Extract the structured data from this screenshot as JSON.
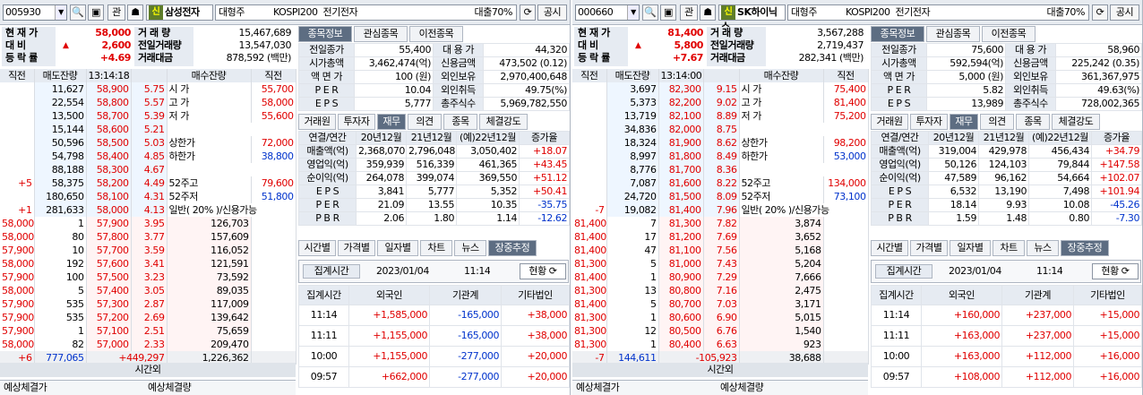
{
  "panels": [
    {
      "code": "005930",
      "btn_kwan": "관",
      "btn_sin": "신",
      "name": "삼성전자",
      "info": "대형주",
      "market": "KOSPI200",
      "sector": "전기전자",
      "loan": "대출70%",
      "gongsi": "공시",
      "cur_label": "현 재 가",
      "cur_price": "58,000",
      "diff_label": "대 비",
      "diff": "2,600",
      "rate_label": "등 락 률",
      "rate": "+4.69",
      "vol_label": "거 래 량",
      "vol": "15,467,689",
      "pvol_label": "전일거래량",
      "pvol": "13,547,030",
      "amt_label": "거래대금",
      "amt": "878,592",
      "amt_unit": "(백만)",
      "ob_head": [
        "직전",
        "매도잔량",
        "13:14:18",
        "",
        "매수잔량",
        "직전"
      ],
      "asks": [
        [
          "",
          "11,627",
          "58,900",
          "5.75",
          "시  가",
          "55,700"
        ],
        [
          "",
          "22,554",
          "58,800",
          "5.57",
          "고  가",
          "58,000"
        ],
        [
          "",
          "13,500",
          "58,700",
          "5.39",
          "저  가",
          "55,600"
        ],
        [
          "",
          "15,144",
          "58,600",
          "5.21",
          "",
          ""
        ],
        [
          "",
          "50,596",
          "58,500",
          "5.03",
          "상한가",
          "72,000"
        ],
        [
          "",
          "54,798",
          "58,400",
          "4.85",
          "하한가",
          "38,800"
        ],
        [
          "",
          "88,188",
          "58,300",
          "4.67",
          "",
          ""
        ],
        [
          "+5",
          "58,375",
          "58,200",
          "4.49",
          "52주고",
          "79,600"
        ],
        [
          "",
          "180,650",
          "58,100",
          "4.31",
          "52주저",
          "51,800"
        ],
        [
          "+1",
          "281,633",
          "58,000",
          "4.13",
          "일반( 20% )/신용가능",
          ""
        ]
      ],
      "bids": [
        [
          "58,000",
          "1",
          "57,900",
          "3.95",
          "126,703"
        ],
        [
          "58,000",
          "80",
          "57,800",
          "3.77",
          "157,609"
        ],
        [
          "57,900",
          "10",
          "57,700",
          "3.59",
          "116,052"
        ],
        [
          "58,000",
          "192",
          "57,600",
          "3.41",
          "121,591"
        ],
        [
          "57,900",
          "100",
          "57,500",
          "3.23",
          "73,592"
        ],
        [
          "58,000",
          "5",
          "57,400",
          "3.05",
          "89,035"
        ],
        [
          "57,900",
          "535",
          "57,300",
          "2.87",
          "117,009"
        ],
        [
          "57,900",
          "535",
          "57,200",
          "2.69",
          "139,642"
        ],
        [
          "57,900",
          "1",
          "57,100",
          "2.51",
          "75,659"
        ],
        [
          "58,000",
          "82",
          "57,000",
          "2.33",
          "209,470"
        ]
      ],
      "tot": [
        "+6",
        "777,065",
        "+449,297",
        "1,226,362"
      ],
      "after": "시간외",
      "exp1": "예상체결가",
      "exp2": "예상체결량",
      "tabs1": [
        "종목정보",
        "관심종목",
        "이전종목"
      ],
      "info_rows": [
        [
          "전일종가",
          "55,400",
          "대 용 가",
          "44,320"
        ],
        [
          "시가총액",
          "3,462,474(억)",
          "신용금액",
          "473,502  (0.12)"
        ],
        [
          "액 면 가",
          "100 (원)",
          "외인보유",
          "2,970,400,648"
        ],
        [
          "P E R",
          "10.04",
          "외인취득",
          "49.75(%)"
        ],
        [
          "E P S",
          "5,777",
          "총주식수",
          "5,969,782,550"
        ]
      ],
      "tabs2": [
        "거래원",
        "투자자",
        "재무",
        "의견",
        "종목",
        "체결강도"
      ],
      "fin_head": [
        "연결",
        "연간",
        "20년12월",
        "21년12월",
        "(예)22년12월",
        "증가율"
      ],
      "fin_rows": [
        [
          "매출액(억)",
          "2,368,070",
          "2,796,048",
          "3,050,402",
          "+18.07"
        ],
        [
          "영업익(억)",
          "359,939",
          "516,339",
          "461,365",
          "+43.45"
        ],
        [
          "순이익(억)",
          "264,078",
          "399,074",
          "369,550",
          "+51.12"
        ],
        [
          "E P S",
          "3,841",
          "5,777",
          "5,352",
          "+50.41"
        ],
        [
          "P E R",
          "21.09",
          "13.55",
          "10.35",
          "-35.75"
        ],
        [
          "P B R",
          "2.06",
          "1.80",
          "1.14",
          "-12.62"
        ]
      ],
      "tabs3": [
        "시간별",
        "가격별",
        "일자별",
        "차트",
        "뉴스",
        "장중추정"
      ],
      "agg_label": "집계시간",
      "agg_date": "2023/01/04",
      "agg_time": "11:14",
      "hyun": "현황",
      "inv_head": [
        "집계시간",
        "외국인",
        "기관계",
        "기타법인"
      ],
      "inv_rows": [
        [
          "11:14",
          "+1,585,000",
          "-165,000",
          "+38,000"
        ],
        [
          "11:11",
          "+1,155,000",
          "-165,000",
          "+38,000"
        ],
        [
          "10:00",
          "+1,155,000",
          "-277,000",
          "+20,000"
        ],
        [
          "09:57",
          "+662,000",
          "-277,000",
          "+20,000"
        ]
      ]
    },
    {
      "code": "000660",
      "btn_kwan": "관",
      "btn_sin": "신",
      "name": "SK하이닉스",
      "info": "대형주",
      "market": "KOSPI200",
      "sector": "전기전자",
      "loan": "대출70%",
      "gongsi": "공시",
      "cur_label": "현 재 가",
      "cur_price": "81,400",
      "diff_label": "대 비",
      "diff": "5,800",
      "rate_label": "등 락 률",
      "rate": "+7.67",
      "vol_label": "거 래 량",
      "vol": "3,567,288",
      "pvol_label": "전일거래량",
      "pvol": "2,719,437",
      "amt_label": "거래대금",
      "amt": "282,341",
      "amt_unit": "(백만)",
      "ob_head": [
        "직전",
        "매도잔량",
        "13:14:00",
        "",
        "매수잔량",
        "직전"
      ],
      "asks": [
        [
          "",
          "3,697",
          "82,300",
          "9.15",
          "시  가",
          "75,400"
        ],
        [
          "",
          "5,373",
          "82,200",
          "9.02",
          "고  가",
          "81,400"
        ],
        [
          "",
          "13,719",
          "82,100",
          "8.89",
          "저  가",
          "75,200"
        ],
        [
          "",
          "34,836",
          "82,000",
          "8.75",
          "",
          ""
        ],
        [
          "",
          "18,324",
          "81,900",
          "8.62",
          "상한가",
          "98,200"
        ],
        [
          "",
          "8,997",
          "81,800",
          "8.49",
          "하한가",
          "53,000"
        ],
        [
          "",
          "8,776",
          "81,700",
          "8.36",
          "",
          ""
        ],
        [
          "",
          "7,087",
          "81,600",
          "8.22",
          "52주고",
          "134,000"
        ],
        [
          "",
          "24,720",
          "81,500",
          "8.09",
          "52주저",
          "73,100"
        ],
        [
          "-7",
          "19,082",
          "81,400",
          "7.96",
          "일반( 20% )/신용가능",
          ""
        ]
      ],
      "bids": [
        [
          "81,400",
          "7",
          "81,300",
          "7.82",
          "3,874"
        ],
        [
          "81,400",
          "17",
          "81,200",
          "7.69",
          "3,652"
        ],
        [
          "81,400",
          "47",
          "81,100",
          "7.56",
          "5,168"
        ],
        [
          "81,300",
          "5",
          "81,000",
          "7.43",
          "5,204"
        ],
        [
          "81,400",
          "1",
          "80,900",
          "7.29",
          "7,666"
        ],
        [
          "81,300",
          "13",
          "80,800",
          "7.16",
          "2,475"
        ],
        [
          "81,400",
          "5",
          "80,700",
          "7.03",
          "3,171"
        ],
        [
          "81,300",
          "1",
          "80,600",
          "6.90",
          "5,015"
        ],
        [
          "81,300",
          "12",
          "80,500",
          "6.76",
          "1,540"
        ],
        [
          "81,300",
          "1",
          "80,400",
          "6.63",
          "923"
        ]
      ],
      "tot": [
        "-7",
        "144,611",
        "-105,923",
        "38,688"
      ],
      "after": "시간외",
      "exp1": "예상체결가",
      "exp2": "예상체결량",
      "tabs1": [
        "종목정보",
        "관심종목",
        "이전종목"
      ],
      "info_rows": [
        [
          "전일종가",
          "75,600",
          "대 용 가",
          "58,960"
        ],
        [
          "시가총액",
          "592,594(억)",
          "신용금액",
          "225,242  (0.35)"
        ],
        [
          "액 면 가",
          "5,000 (원)",
          "외인보유",
          "361,367,975"
        ],
        [
          "P E R",
          "5.82",
          "외인취득",
          "49.63(%)"
        ],
        [
          "E P S",
          "13,989",
          "총주식수",
          "728,002,365"
        ]
      ],
      "tabs2": [
        "거래원",
        "투자자",
        "재무",
        "의견",
        "종목",
        "체결강도"
      ],
      "fin_head": [
        "연결",
        "연간",
        "20년12월",
        "21년12월",
        "(예)22년12월",
        "증가율"
      ],
      "fin_rows": [
        [
          "매출액(억)",
          "319,004",
          "429,978",
          "456,434",
          "+34.79"
        ],
        [
          "영업익(억)",
          "50,126",
          "124,103",
          "79,844",
          "+147.58"
        ],
        [
          "순이익(억)",
          "47,589",
          "96,162",
          "54,664",
          "+102.07"
        ],
        [
          "E P S",
          "6,532",
          "13,190",
          "7,498",
          "+101.94"
        ],
        [
          "P E R",
          "18.14",
          "9.93",
          "10.08",
          "-45.26"
        ],
        [
          "P B R",
          "1.59",
          "1.48",
          "0.80",
          "-7.30"
        ]
      ],
      "tabs3": [
        "시간별",
        "가격별",
        "일자별",
        "차트",
        "뉴스",
        "장중추정"
      ],
      "agg_label": "집계시간",
      "agg_date": "2023/01/04",
      "agg_time": "11:14",
      "hyun": "현황",
      "inv_head": [
        "집계시간",
        "외국인",
        "기관계",
        "기타법인"
      ],
      "inv_rows": [
        [
          "11:14",
          "+160,000",
          "+237,000",
          "+15,000"
        ],
        [
          "11:11",
          "+163,000",
          "+237,000",
          "+15,000"
        ],
        [
          "10:00",
          "+163,000",
          "+112,000",
          "+16,000"
        ],
        [
          "09:57",
          "+108,000",
          "+112,000",
          "+16,000"
        ]
      ]
    }
  ]
}
